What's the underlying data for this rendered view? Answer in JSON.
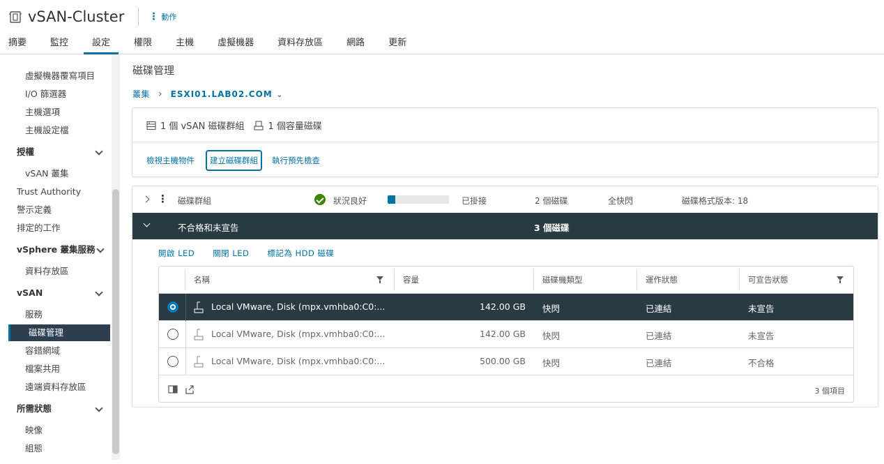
{
  "header": {
    "title": "vSAN-Cluster",
    "actions_label": "動作",
    "tabs": [
      {
        "label": "摘要",
        "active": false
      },
      {
        "label": "監控",
        "active": false
      },
      {
        "label": "設定",
        "active": true
      },
      {
        "label": "權限",
        "active": false
      },
      {
        "label": "主機",
        "active": false
      },
      {
        "label": "虛擬機器",
        "active": false
      },
      {
        "label": "資料存放區",
        "active": false
      },
      {
        "label": "網路",
        "active": false
      },
      {
        "label": "更新",
        "active": false
      }
    ]
  },
  "sidebar": {
    "items": [
      {
        "label": "虛擬機器覆寫項目",
        "type": "sub"
      },
      {
        "label": "I/O 篩選器",
        "type": "sub"
      },
      {
        "label": "主機選項",
        "type": "sub"
      },
      {
        "label": "主機設定檔",
        "type": "sub"
      },
      {
        "label": "授權",
        "type": "group"
      },
      {
        "label": "vSAN 叢集",
        "type": "sub"
      },
      {
        "label": "Trust Authority",
        "type": "plain"
      },
      {
        "label": "警示定義",
        "type": "plain"
      },
      {
        "label": "排定的工作",
        "type": "plain"
      },
      {
        "label": "vSphere 叢集服務",
        "type": "group"
      },
      {
        "label": "資料存放區",
        "type": "sub"
      },
      {
        "label": "vSAN",
        "type": "group"
      },
      {
        "label": "服務",
        "type": "sub"
      },
      {
        "label": "磁碟管理",
        "type": "selected"
      },
      {
        "label": "容錯網域",
        "type": "sub"
      },
      {
        "label": "檔案共用",
        "type": "sub"
      },
      {
        "label": "遠端資料存放區",
        "type": "sub"
      },
      {
        "label": "所需狀態",
        "type": "group"
      },
      {
        "label": "映像",
        "type": "sub"
      },
      {
        "label": "組態",
        "type": "sub"
      }
    ]
  },
  "main": {
    "page_title": "磁碟管理",
    "breadcrumb": {
      "root": "叢集",
      "host": "ESXI01.LAB02.COM"
    },
    "summary": {
      "disk_groups": "1 個 vSAN 磁碟群組",
      "capacity_disks": "1 個容量磁碟"
    },
    "card_actions": {
      "view_objects": "檢視主機物件",
      "create_group": "建立磁碟群組",
      "precheck": "執行預先檢查"
    },
    "disk_group_row": {
      "name": "磁碟群組",
      "health": "狀況良好",
      "usage_fraction": 0.13,
      "mount": "已掛接",
      "disks": "2 個磁碟",
      "type": "全快閃",
      "format": "磁碟格式版本: 18"
    },
    "ineligible_row": {
      "label": "不合格和未宣告",
      "count": "3 個磁碟"
    },
    "led_actions": {
      "on": "開啟 LED",
      "off": "關閉 LED",
      "mark_hdd": "標記為 HDD 磁碟"
    },
    "grid": {
      "columns": {
        "name": "名稱",
        "capacity": "容量",
        "drive_type": "磁碟機類型",
        "op_state": "運作狀態",
        "claim_state": "可宣告狀態"
      },
      "rows": [
        {
          "name": "Local VMware, Disk (mpx.vmhba0:C0:...",
          "capacity": "142.00 GB",
          "drive_type": "快閃",
          "op_state": "已連結",
          "claim_state": "未宣告",
          "selected": true
        },
        {
          "name": "Local VMware, Disk (mpx.vmhba0:C0:...",
          "capacity": "142.00 GB",
          "drive_type": "快閃",
          "op_state": "已連結",
          "claim_state": "未宣告",
          "selected": false
        },
        {
          "name": "Local VMware, Disk (mpx.vmhba0:C0:...",
          "capacity": "500.00 GB",
          "drive_type": "快閃",
          "op_state": "已連結",
          "claim_state": "不合格",
          "selected": false
        }
      ],
      "footer_count": "3 個項目"
    }
  },
  "colors": {
    "accent": "#0072a3",
    "dark_row": "#2a3a42",
    "health_ok": "#3c8500"
  }
}
